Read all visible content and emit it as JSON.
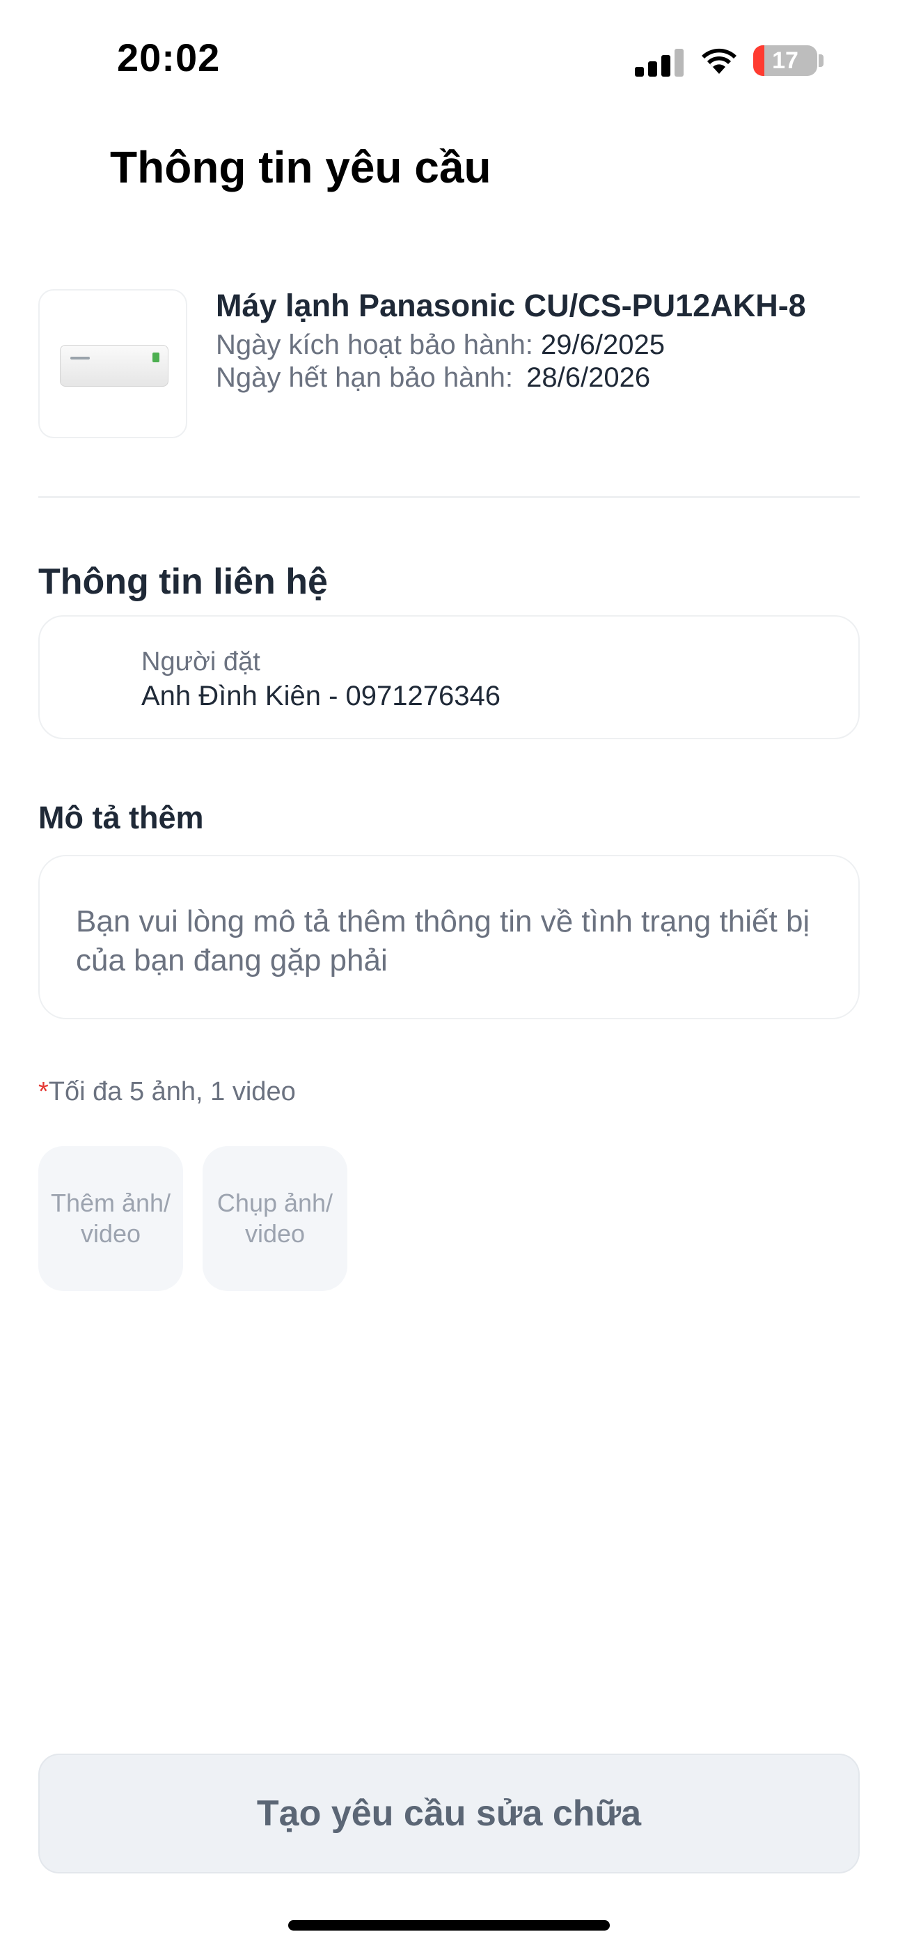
{
  "status_bar": {
    "time": "20:02",
    "battery_level": "17",
    "icons": [
      "signal-icon",
      "wifi-icon",
      "battery-icon"
    ]
  },
  "header": {
    "title": "Thông tin yêu cầu"
  },
  "product": {
    "name": "Máy lạnh Panasonic CU/CS-PU12AKH-8",
    "activation_label": "Ngày kích hoạt bảo hành:",
    "activation_date": "29/6/2025",
    "expiry_label": "Ngày hết hạn bảo hành:",
    "expiry_date": "28/6/2026",
    "image": "air-conditioner-image"
  },
  "contact": {
    "heading": "Thông tin liên hệ",
    "label": "Người đặt",
    "value": "Anh Đình Kiên - 0971276346"
  },
  "description": {
    "heading": "Mô tả thêm",
    "placeholder": "Bạn vui lòng mô tả thêm thông tin về tình trạng thiết bị của bạn đang gặp phải",
    "value": ""
  },
  "media": {
    "required_mark": "*",
    "note": "Tối đa 5 ảnh, 1 video",
    "add_button": "Thêm ảnh/\nvideo",
    "capture_button": "Chụp ảnh/\nvideo"
  },
  "submit": {
    "label": "Tạo yêu cầu sửa chữa"
  },
  "colors": {
    "text_primary": "#1f2937",
    "text_secondary": "#6b7280",
    "required": "#e53935",
    "button_disabled_bg": "#eef1f5",
    "battery_low": "#ff3b30"
  }
}
